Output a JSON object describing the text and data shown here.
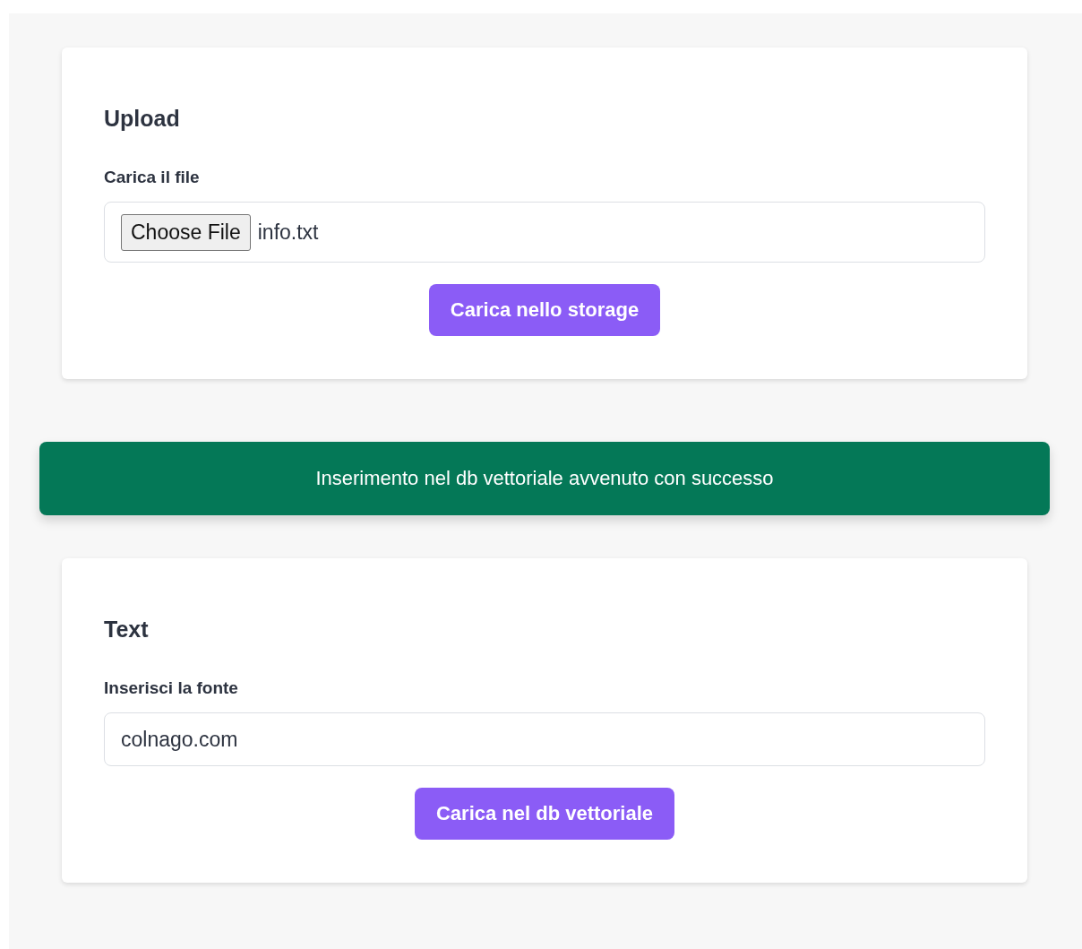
{
  "upload_card": {
    "title": "Upload",
    "label": "Carica il file",
    "file_button": "Choose File",
    "file_name": "info.txt",
    "submit": "Carica nello storage"
  },
  "alert": {
    "message": "Inserimento nel db vettoriale avvenuto con successo",
    "color": "#047857"
  },
  "text_card": {
    "title": "Text",
    "label": "Inserisci la fonte",
    "value": "colnago.com",
    "submit": "Carica nel db vettoriale"
  }
}
